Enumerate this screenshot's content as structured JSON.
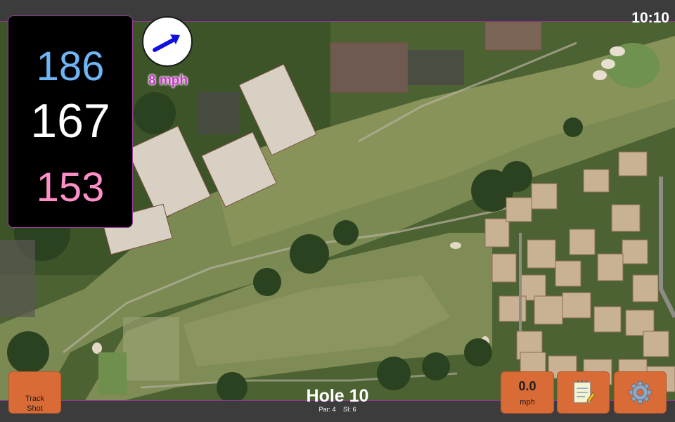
{
  "clock": {
    "time": "10:10"
  },
  "distances": {
    "back": "186",
    "center": "167",
    "front": "153",
    "colors": {
      "back": "#6fb4f4",
      "center": "#ffffff",
      "front": "#ff8fc7"
    }
  },
  "wind": {
    "speed_label": "8 mph",
    "direction_icon": "arrow-northeast-icon",
    "arrow_color": "#1010dd"
  },
  "buttons": {
    "track_shot": "Track\nShot",
    "speed_value": "0.0",
    "speed_unit": "mph",
    "notes_icon": "notepad-icon",
    "settings_icon": "gear-icon",
    "accent": "#d96b37"
  },
  "hole": {
    "title": "Hole 10",
    "par": "Par: 4",
    "si": "SI: 6"
  }
}
